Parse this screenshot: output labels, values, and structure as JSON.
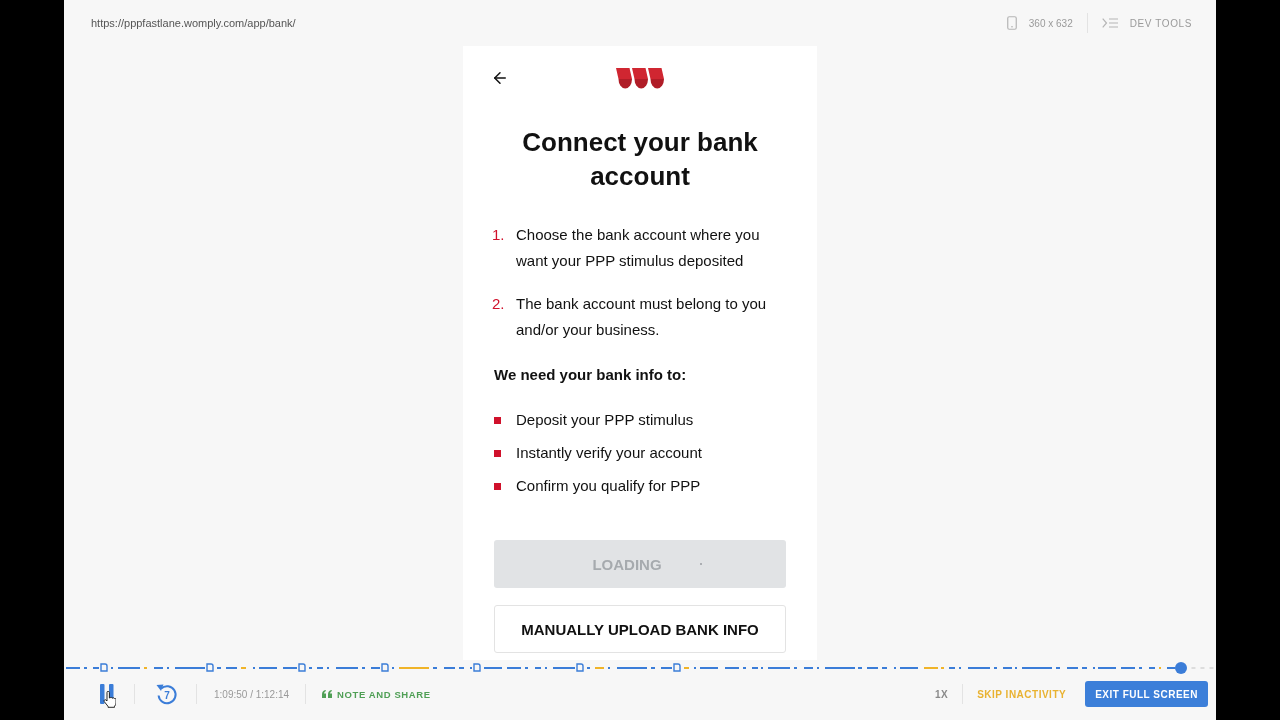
{
  "browser": {
    "url": "https://pppfastlane.womply.com/app/bank/",
    "viewport": "360 x 632",
    "dev_tools": "DEV TOOLS"
  },
  "page": {
    "title": "Connect your bank account",
    "steps": [
      {
        "number": "1.",
        "text": "Choose the bank account where you want your PPP stimulus deposited"
      },
      {
        "number": "2.",
        "text": "The bank account must belong to you and/or your business."
      }
    ],
    "reasons_heading": "We need your bank info to:",
    "reasons": [
      "Deposit your PPP stimulus",
      "Instantly verify your account",
      "Confirm you qualify for PPP"
    ],
    "buttons": [
      {
        "label": "LOADING",
        "kind": "loading",
        "disabled": true
      },
      {
        "label": "MANUALLY UPLOAD BANK INFO",
        "kind": "outline",
        "disabled": false
      }
    ]
  },
  "player": {
    "progress": {
      "level": 0.97
    },
    "playing": true,
    "rewind_seconds": "7",
    "time": "1:09:50 / 1:12:14",
    "note_and_share": "NOTE AND SHARE",
    "speed": "1X",
    "skip_inactivity": "SKIP INACTIVITY",
    "exit_full_screen": "EXIT FULL SCREEN"
  }
}
